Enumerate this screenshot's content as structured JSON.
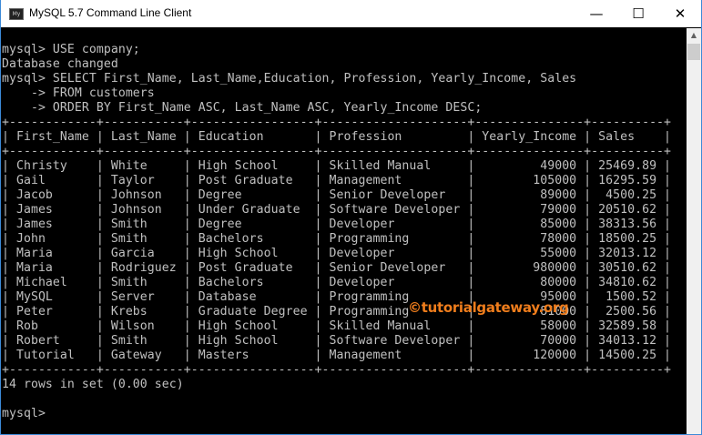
{
  "window": {
    "title": "MySQL 5.7 Command Line Client",
    "icon": "mysql-console-icon",
    "minimize_label": "—",
    "maximize_label": "☐",
    "close_label": "✕"
  },
  "terminal": {
    "prompt": "mysql>",
    "commands_before": [
      "mysql> USE company;",
      "Database changed",
      "mysql> SELECT First_Name, Last_Name,Education, Profession, Yearly_Income, Sales",
      "    -> FROM customers",
      "    -> ORDER BY First_Name ASC, Last_Name ASC, Yearly_Income DESC;"
    ],
    "table": {
      "columns": [
        "First_Name",
        "Last_Name",
        "Education",
        "Profession",
        "Yearly_Income",
        "Sales"
      ],
      "right_aligned": [
        false,
        false,
        false,
        false,
        true,
        true
      ],
      "rows": [
        [
          "Christy",
          "White",
          "High School",
          "Skilled Manual",
          "49000",
          "25469.89"
        ],
        [
          "Gail",
          "Taylor",
          "Post Graduate",
          "Management",
          "105000",
          "16295.59"
        ],
        [
          "Jacob",
          "Johnson",
          "Degree",
          "Senior Developer",
          "89000",
          "4500.25"
        ],
        [
          "James",
          "Johnson",
          "Under Graduate",
          "Software Developer",
          "79000",
          "20510.62"
        ],
        [
          "James",
          "Smith",
          "Degree",
          "Developer",
          "85000",
          "38313.56"
        ],
        [
          "John",
          "Smith",
          "Bachelors",
          "Programming",
          "78000",
          "18500.25"
        ],
        [
          "Maria",
          "Garcia",
          "High School",
          "Developer",
          "55000",
          "32013.12"
        ],
        [
          "Maria",
          "Rodriguez",
          "Post Graduate",
          "Senior Developer",
          "980000",
          "30510.62"
        ],
        [
          "Michael",
          "Smith",
          "Bachelors",
          "Developer",
          "80000",
          "34810.62"
        ],
        [
          "MySQL",
          "Server",
          "Database",
          "Programming",
          "95000",
          "1500.52"
        ],
        [
          "Peter",
          "Krebs",
          "Graduate Degree",
          "Programming",
          "81000",
          "2500.56"
        ],
        [
          "Rob",
          "Wilson",
          "High School",
          "Skilled Manual",
          "58000",
          "32589.58"
        ],
        [
          "Robert",
          "Smith",
          "High School",
          "Software Developer",
          "70000",
          "34013.12"
        ],
        [
          "Tutorial",
          "Gateway",
          "Masters",
          "Management",
          "120000",
          "14500.25"
        ]
      ]
    },
    "result_summary": "14 rows in set (0.00 sec)",
    "final_prompt": "mysql> "
  },
  "watermark": "©tutorialgateway.org",
  "colors": {
    "terminal_bg": "#000000",
    "terminal_text": "#c0c0c0",
    "watermark": "#ef7d1c",
    "window_border": "#3c8ad8"
  }
}
